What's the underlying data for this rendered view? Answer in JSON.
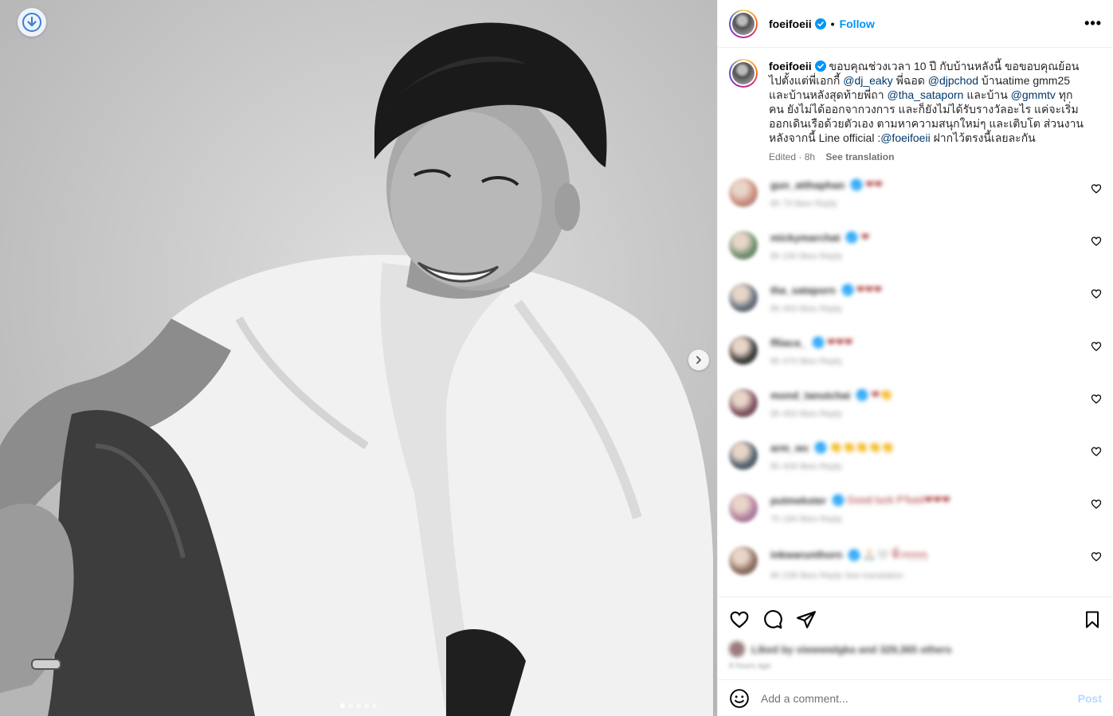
{
  "post": {
    "username": "foeifoeii",
    "follow_label": "Follow",
    "more_icon": "more-horizontal-icon"
  },
  "caption": {
    "username": "foeifoeii",
    "t1": " ขอบคุณช่วงเวลา 10 ปี กับบ้านหลังนี้ ขอขอบคุณย้อนไปตั้งแต่พี่เอกกี้ ",
    "m1": "@dj_eaky",
    "t2": " พี่ฉอด ",
    "m2": "@djpchod",
    "t3": " บ้านatime gmm25 และบ้านหลังสุดท้ายพี่ถา ",
    "m3": "@tha_sataporn",
    "t4": " และบ้าน ",
    "m4": "@gmmtv",
    "t5": " ทุกคน ยังไม่ได้ออกจากวงการ และก็ยังไม่ได้รับรางวัลอะไร แค่จะเริ่มออกเดินเรือด้วยตัวเอง ตามหาความสนุกใหม่ๆ และเติบโต ส่วนงานหลังจากนี้ Line official :",
    "m5": "@foeifoeii",
    "t6": " ฝากไว้ตรงนี้เลยละกัน",
    "meta": "Edited · 8h",
    "see_translation": "See translation"
  },
  "comments": [
    {
      "user": "gun_atthaphan",
      "text": "❤❤",
      "sub": "8h  79 likes  Reply",
      "avatar_color": "#c98a7a"
    },
    {
      "user": "mickymarchat",
      "text": "❤",
      "sub": "8h  230 likes  Reply",
      "avatar_color": "#6a8d6a"
    },
    {
      "user": "tha_sataporn",
      "text": "❤❤❤",
      "sub": "8h  493 likes  Reply",
      "avatar_color": "#5c6b7a"
    },
    {
      "user": "ffiiaca_",
      "text": "❤❤❤",
      "sub": "8h  470 likes  Reply",
      "avatar_color": "#333333"
    },
    {
      "user": "mond_tanutchai",
      "text": "❤👏",
      "sub": "8h  493 likes  Reply",
      "avatar_color": "#7a4a5a"
    },
    {
      "user": "arm_wc",
      "text": "👏👏👏👏👏",
      "sub": "8h  408 likes  Reply",
      "avatar_color": "#4a5a6a"
    },
    {
      "user": "putmekster",
      "text": "Good luck P'foeii❤❤❤",
      "sub": "7h  184 likes  Reply",
      "avatar_color": "#b07aa0"
    },
    {
      "user": "inkwarunthorn",
      "text": "🙏🏻🤍 ฟิ้วๆๆๆๆ",
      "sub": "8h  238 likes  Reply  See translation",
      "avatar_color": "#8a6a5a"
    }
  ],
  "likes": {
    "text": "Liked by viewwwlgka and 329,365 others",
    "ago": "9 hours ago"
  },
  "add_comment": {
    "placeholder": "Add a comment...",
    "post_label": "Post"
  },
  "colors": {
    "accent": "#0095f6",
    "mention": "#00376b"
  }
}
